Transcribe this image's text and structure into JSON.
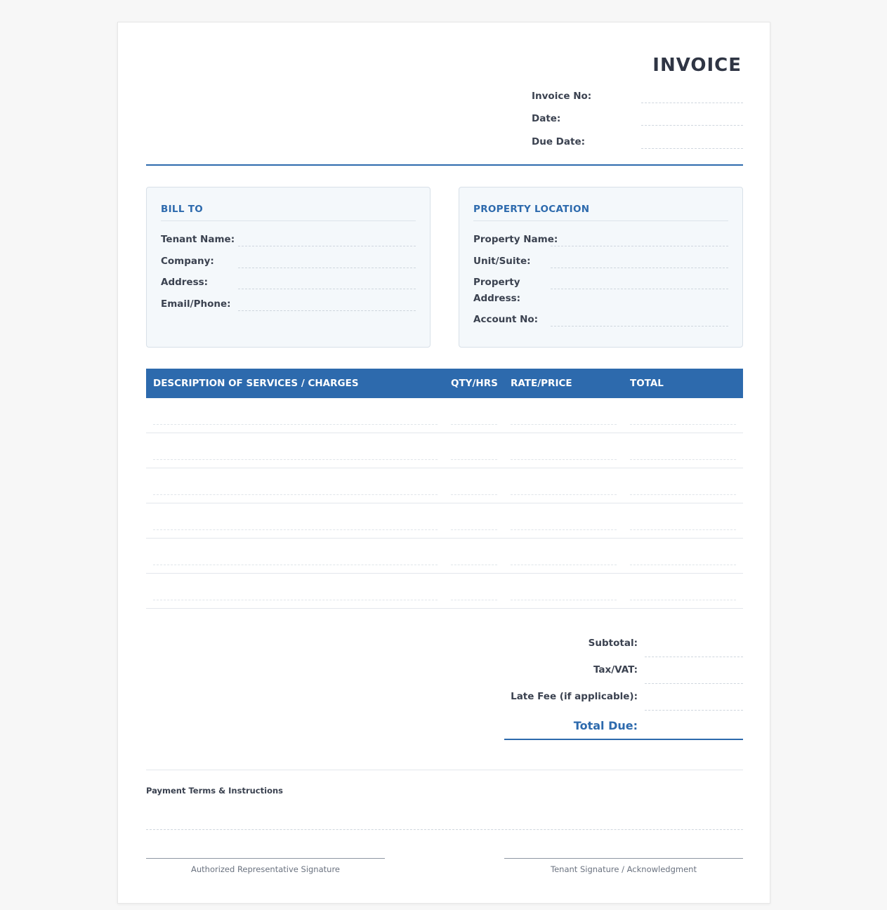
{
  "header": {
    "title": "INVOICE",
    "meta": [
      {
        "label": "Invoice No:",
        "value": ""
      },
      {
        "label": "Date:",
        "value": ""
      },
      {
        "label": "Due Date:",
        "value": ""
      }
    ]
  },
  "bill_to": {
    "title": "BILL TO",
    "fields": [
      {
        "label": "Tenant Name:",
        "value": ""
      },
      {
        "label": "Company:",
        "value": ""
      },
      {
        "label": "Address:",
        "value": ""
      },
      {
        "label": "Email/Phone:",
        "value": ""
      }
    ]
  },
  "property": {
    "title": "PROPERTY LOCATION",
    "fields": [
      {
        "label": "Property Name:",
        "value": ""
      },
      {
        "label": "Unit/Suite:",
        "value": ""
      },
      {
        "label": "Property Address:",
        "value": ""
      },
      {
        "label": "Account No:",
        "value": ""
      }
    ]
  },
  "table": {
    "columns": [
      "DESCRIPTION OF SERVICES / CHARGES",
      "QTY/HRS",
      "RATE/PRICE",
      "TOTAL"
    ],
    "rows": [
      [
        "",
        "",
        "",
        ""
      ],
      [
        "",
        "",
        "",
        ""
      ],
      [
        "",
        "",
        "",
        ""
      ],
      [
        "",
        "",
        "",
        ""
      ],
      [
        "",
        "",
        "",
        ""
      ],
      [
        "",
        "",
        "",
        ""
      ]
    ]
  },
  "totals": {
    "subtotal_label": "Subtotal:",
    "tax_label": "Tax/VAT:",
    "late_fee_label": "Late Fee (if applicable):",
    "total_due_label": "Total Due:"
  },
  "footer": {
    "terms_title": "Payment Terms & Instructions",
    "signature_left": "Authorized Representative Signature",
    "signature_right": "Tenant Signature / Acknowledgment"
  },
  "colors": {
    "accent": "#2d6aad",
    "text": "#3b4250",
    "box_bg": "#f4f8fb"
  }
}
